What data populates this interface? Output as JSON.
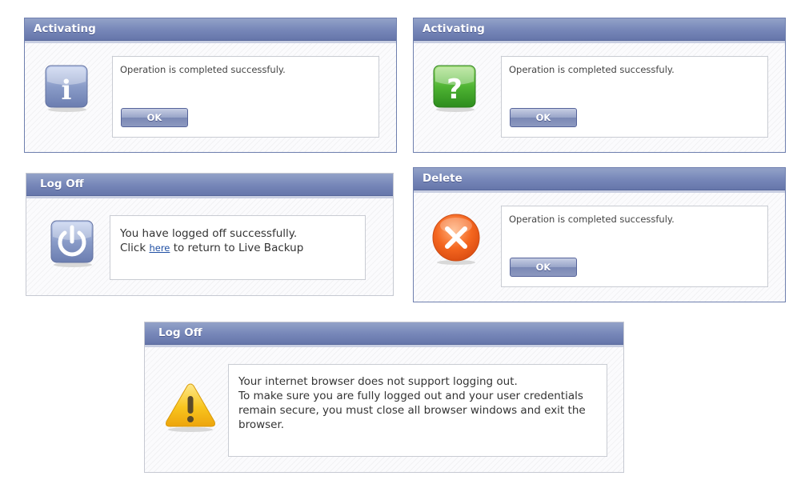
{
  "dialogs": [
    {
      "title": "Activating",
      "message": "Operation is completed successfuly.",
      "ok_label": "OK",
      "icon": "info-icon"
    },
    {
      "title": "Activating",
      "message": "Operation is completed successfuly.",
      "ok_label": "OK",
      "icon": "question-icon"
    },
    {
      "title": "Log Off",
      "line1": "You have logged off successfully.",
      "click_prefix": "Click",
      "link_text": "here",
      "click_suffix": "to return to Live Backup",
      "icon": "power-icon"
    },
    {
      "title": "Delete",
      "message": "Operation is completed successfuly.",
      "ok_label": "OK",
      "icon": "error-x-icon"
    },
    {
      "title": "Log Off",
      "lines": [
        "Your internet browser does not support logging out.",
        "To make sure you are fully logged out and your user credentials",
        "remain secure, you must close all browser windows and exit the",
        "browser."
      ],
      "icon": "warning-icon"
    }
  ],
  "colors": {
    "title_bar": "#7686b8",
    "border": "#6e7fae",
    "info": "#8a9cc8",
    "question": "#3fa92c",
    "error": "#ef5a1f",
    "warning": "#f7c51b"
  }
}
